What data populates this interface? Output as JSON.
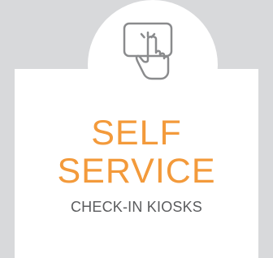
{
  "hero": {
    "icon": "touch-screen-tap-icon",
    "title_line_1": "SELF",
    "title_line_2": "SERVICE",
    "subtitle": "CHECK-IN KIOSKS"
  },
  "colors": {
    "background": "#d8d9db",
    "card": "#ffffff",
    "accent": "#f39a3b",
    "text": "#5a5b5d",
    "icon_stroke": "#8a8b8d"
  }
}
